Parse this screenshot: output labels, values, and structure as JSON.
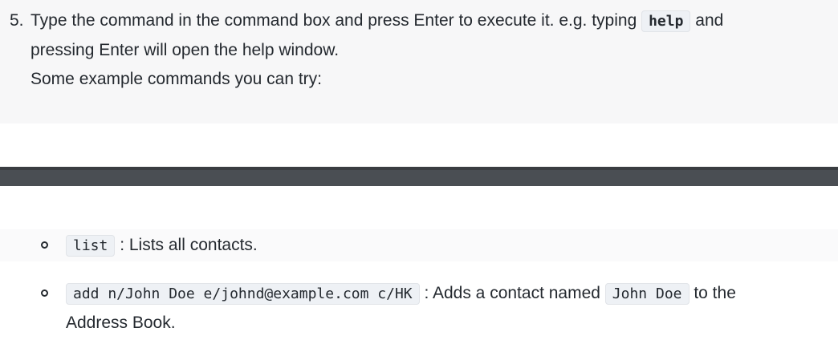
{
  "step": {
    "number": "5.",
    "text_before": "Type the command in the command box and press Enter to execute it. e.g. typing ",
    "code": "help",
    "text_after": " and",
    "line2": "pressing Enter will open the help window.",
    "line3": "Some example commands you can try:"
  },
  "examples": [
    {
      "command": "list",
      "description": " : Lists all contacts."
    },
    {
      "command": "add n/John Doe e/johnd@example.com c/HK",
      "description_before": " : Adds a contact named ",
      "inline_code": "John Doe",
      "description_after": " to the",
      "line2": "Address Book."
    }
  ]
}
